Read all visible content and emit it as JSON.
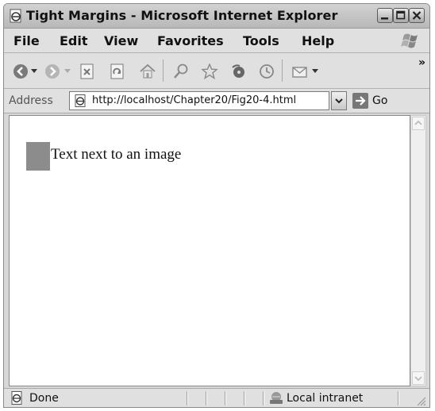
{
  "window": {
    "title": "Tight Margins - Microsoft Internet Explorer"
  },
  "menu": {
    "items": [
      "File",
      "Edit",
      "View",
      "Favorites",
      "Tools",
      "Help"
    ]
  },
  "toolbar": {
    "icons": [
      "back-icon",
      "forward-icon",
      "stop-icon",
      "refresh-icon",
      "home-icon",
      "search-icon",
      "favorites-icon",
      "media-icon",
      "history-icon",
      "mail-icon"
    ],
    "overflow": "»"
  },
  "address": {
    "label": "Address",
    "url": "http://localhost/Chapter20/Fig20-4.html",
    "go_label": "Go"
  },
  "content": {
    "text": "Text next to an image"
  },
  "status": {
    "text": "Done",
    "zone": "Local intranet"
  }
}
